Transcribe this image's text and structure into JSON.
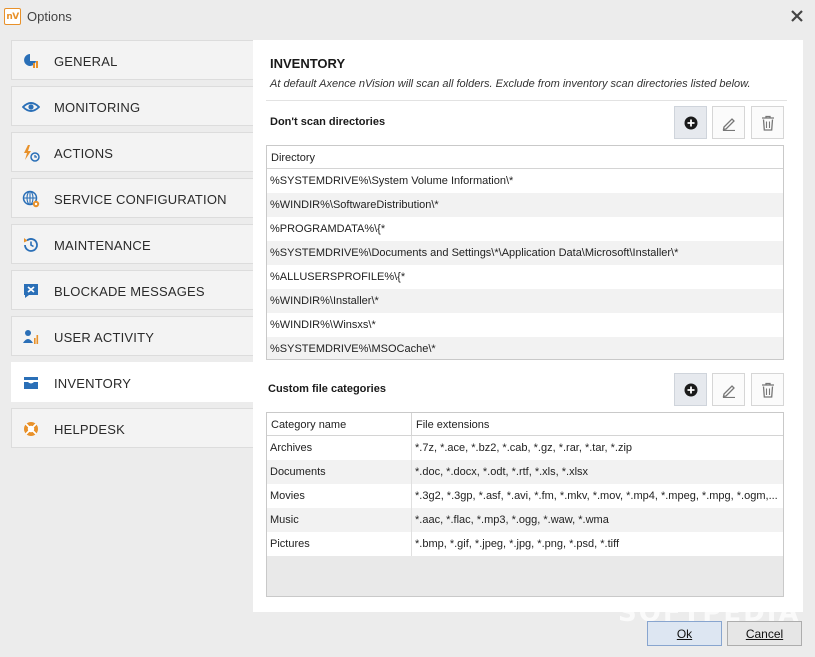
{
  "window": {
    "app_icon": "nV",
    "title": "Options"
  },
  "sidebar": {
    "items": [
      {
        "label": "GENERAL",
        "icon": "general-icon"
      },
      {
        "label": "MONITORING",
        "icon": "eye-icon"
      },
      {
        "label": "ACTIONS",
        "icon": "actions-icon"
      },
      {
        "label": "SERVICE CONFIGURATION",
        "icon": "globe-gear-icon"
      },
      {
        "label": "MAINTENANCE",
        "icon": "clock-refresh-icon"
      },
      {
        "label": "BLOCKADE MESSAGES",
        "icon": "message-block-icon"
      },
      {
        "label": "USER ACTIVITY",
        "icon": "user-activity-icon"
      },
      {
        "label": "INVENTORY",
        "icon": "inventory-tray-icon",
        "active": true
      },
      {
        "label": "HELPDESK",
        "icon": "lifebuoy-icon"
      }
    ]
  },
  "main": {
    "title": "INVENTORY",
    "description": "At default Axence nVision will scan all folders. Exclude from inventory scan directories listed below.",
    "dirs_section": {
      "label": "Don't scan directories",
      "column": "Directory",
      "rows": [
        "%SYSTEMDRIVE%\\System Volume Information\\*",
        "%WINDIR%\\SoftwareDistribution\\*",
        "%PROGRAMDATA%\\{*",
        "%SYSTEMDRIVE%\\Documents and Settings\\*\\Application Data\\Microsoft\\Installer\\*",
        "%ALLUSERSPROFILE%\\{*",
        "%WINDIR%\\Installer\\*",
        "%WINDIR%\\Winsxs\\*",
        "%SYSTEMDRIVE%\\MSOCache\\*"
      ]
    },
    "categories_section": {
      "label": "Custom file categories",
      "columns": [
        "Category name",
        "File extensions"
      ],
      "rows": [
        {
          "name": "Archives",
          "ext": "*.7z, *.ace, *.bz2, *.cab, *.gz, *.rar, *.tar, *.zip"
        },
        {
          "name": "Documents",
          "ext": "*.doc, *.docx, *.odt, *.rtf, *.xls, *.xlsx"
        },
        {
          "name": "Movies",
          "ext": "*.3g2, *.3gp, *.asf, *.avi, *.fm, *.mkv, *.mov, *.mp4, *.mpeg, *.mpg, *.ogm,..."
        },
        {
          "name": "Music",
          "ext": "*.aac, *.flac, *.mp3, *.ogg, *.waw, *.wma"
        },
        {
          "name": "Pictures",
          "ext": "*.bmp, *.gif, *.jpeg, *.jpg, *.png, *.psd, *.tiff"
        }
      ]
    }
  },
  "footer": {
    "ok": "Ok",
    "cancel": "Cancel"
  },
  "watermark": "SOFTPEDIA",
  "colors": {
    "accent_blue": "#2a6fb7",
    "accent_orange": "#e8912a"
  }
}
